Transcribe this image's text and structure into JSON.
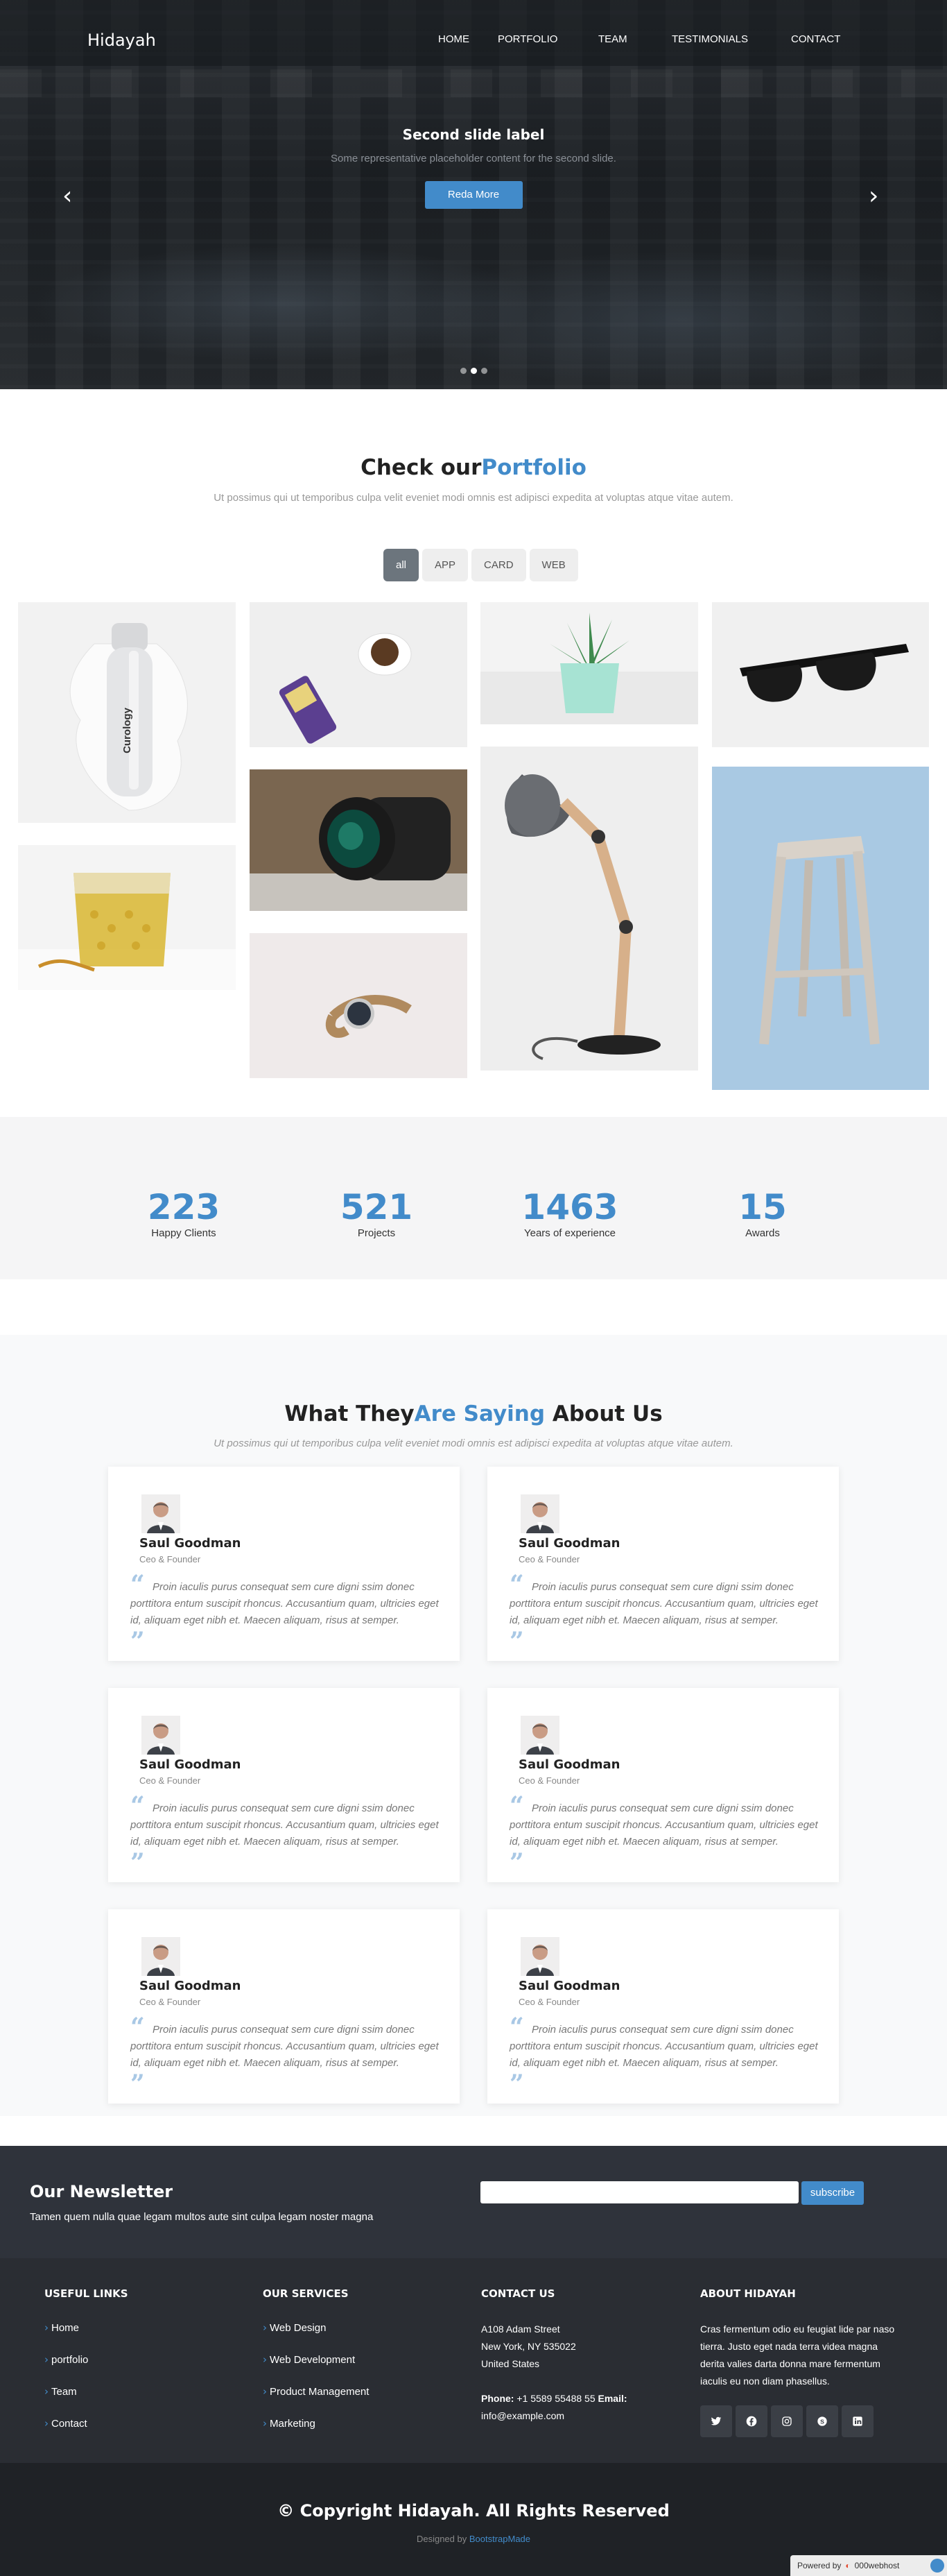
{
  "header": {
    "logo": "Hidayah",
    "nav": [
      "HOME",
      "PORTFOLIO",
      "TEAM",
      "TESTIMONIALS",
      "CONTACT"
    ]
  },
  "hero": {
    "title": "Second slide label",
    "subtitle": "Some representative placeholder content for the second slide.",
    "button": "Reda More",
    "prev_icon": "chevron-left-icon",
    "next_icon": "chevron-right-icon",
    "active_slide": 2,
    "slide_count": 3
  },
  "portfolio": {
    "title_main": "Check our",
    "title_accent": "Portfolio",
    "subtitle": "Ut possimus qui ut temporibus culpa velit eveniet modi omnis est adipisci expedita at voluptas atque vitae autem.",
    "filters": [
      "all",
      "APP",
      "CARD",
      "WEB"
    ],
    "active_filter": "all",
    "items": [
      {
        "name": "skincare-bottle",
        "label": "Curology"
      },
      {
        "name": "honey-glass"
      },
      {
        "name": "coffee-and-tea"
      },
      {
        "name": "camera-lens"
      },
      {
        "name": "wrist-watch"
      },
      {
        "name": "succulent-plant"
      },
      {
        "name": "desk-lamp"
      },
      {
        "name": "sunglasses"
      },
      {
        "name": "wooden-stool"
      }
    ]
  },
  "stats": [
    {
      "number": "223",
      "label": "Happy Clients"
    },
    {
      "number": "521",
      "label": "Projects"
    },
    {
      "number": "1463",
      "label": "Years of experience"
    },
    {
      "number": "15",
      "label": "Awards"
    }
  ],
  "testimonials": {
    "title_main": "What They",
    "title_accent": "Are Saying",
    "title_end": "About Us",
    "subtitle": "Ut possimus qui ut temporibus culpa velit eveniet modi omnis est adipisci expedita at voluptas atque vitae autem.",
    "items": [
      {
        "name": "Saul Goodman",
        "role": "Ceo & Founder",
        "text": "Proin iaculis purus consequat sem cure digni ssim donec porttitora entum suscipit rhoncus. Accusantium quam, ultricies eget id, aliquam eget nibh et. Maecen aliquam, risus at semper."
      },
      {
        "name": "Saul Goodman",
        "role": "Ceo & Founder",
        "text": "Proin iaculis purus consequat sem cure digni ssim donec porttitora entum suscipit rhoncus. Accusantium quam, ultricies eget id, aliquam eget nibh et. Maecen aliquam, risus at semper."
      },
      {
        "name": "Saul Goodman",
        "role": "Ceo & Founder",
        "text": "Proin iaculis purus consequat sem cure digni ssim donec porttitora entum suscipit rhoncus. Accusantium quam, ultricies eget id, aliquam eget nibh et. Maecen aliquam, risus at semper."
      },
      {
        "name": "Saul Goodman",
        "role": "Ceo & Founder",
        "text": "Proin iaculis purus consequat sem cure digni ssim donec porttitora entum suscipit rhoncus. Accusantium quam, ultricies eget id, aliquam eget nibh et. Maecen aliquam, risus at semper."
      },
      {
        "name": "Saul Goodman",
        "role": "Ceo & Founder",
        "text": "Proin iaculis purus consequat sem cure digni ssim donec porttitora entum suscipit rhoncus. Accusantium quam, ultricies eget id, aliquam eget nibh et. Maecen aliquam, risus at semper."
      },
      {
        "name": "Saul Goodman",
        "role": "Ceo & Founder",
        "text": "Proin iaculis purus consequat sem cure digni ssim donec porttitora entum suscipit rhoncus. Accusantium quam, ultricies eget id, aliquam eget nibh et. Maecen aliquam, risus at semper."
      }
    ]
  },
  "newsletter": {
    "title": "Our Newsletter",
    "text": "Tamen quem nulla quae legam multos aute sint culpa legam noster magna",
    "input_value": "",
    "button": "subscribe"
  },
  "footer": {
    "useful_links": {
      "title": "USEFUL LINKS",
      "items": [
        "Home",
        "portfolio",
        "Team",
        "Contact"
      ]
    },
    "services": {
      "title": "OUR SERVICES",
      "items": [
        "Web Design",
        "Web Development",
        "Product Management",
        "Marketing"
      ]
    },
    "contact": {
      "title": "CONTACT US",
      "address1": "A108 Adam Street",
      "address2": "New York, NY 535022",
      "address3": "United States",
      "phone_label": "Phone:",
      "phone": "+1 5589 55488 55",
      "email_label": "Email:",
      "email": "info@example.com"
    },
    "about": {
      "title": "ABOUT HIDAYAH",
      "text": "Cras fermentum odio eu feugiat lide par naso tierra. Justo eget nada terra videa magna derita valies darta donna mare fermentum iaculis eu non diam phasellus."
    },
    "socials": [
      "twitter-icon",
      "facebook-icon",
      "instagram-icon",
      "skype-icon",
      "linkedin-icon"
    ],
    "copyright": "© Copyright Hidayah. All Rights Reserved",
    "designed_by": "Designed by",
    "designer": "BootstrapMade",
    "powered_by": "Powered by",
    "host": "000webhost"
  },
  "colors": {
    "accent": "#428bca",
    "hero_bg": "#1f2327",
    "stats_bg": "#f5f5f6",
    "footer_bg": "#2a2d33",
    "newsletter_bg": "#2f333b"
  }
}
